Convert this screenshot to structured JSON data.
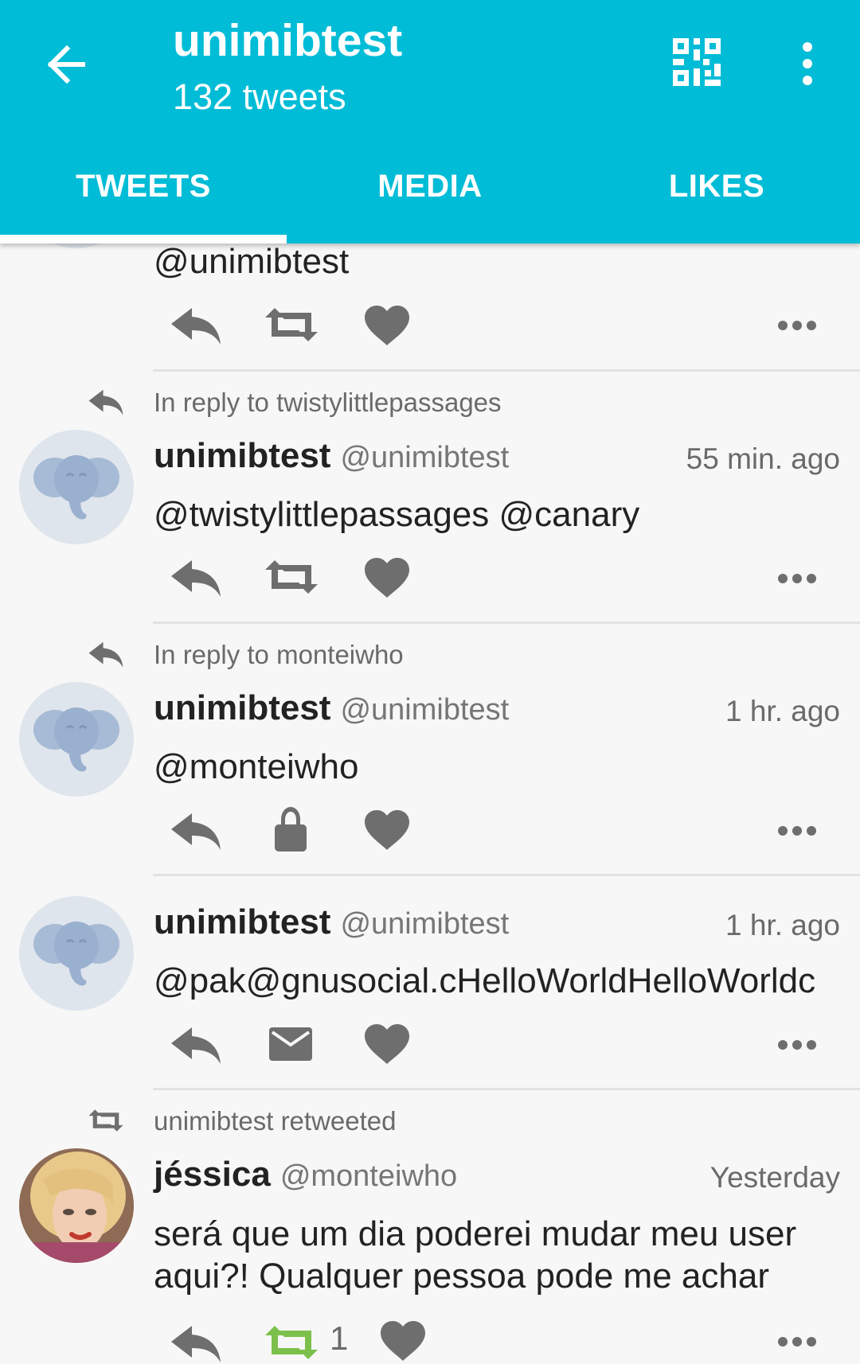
{
  "header": {
    "title": "unimibtest",
    "subtitle": "132 tweets",
    "tabs": [
      "TWEETS",
      "MEDIA",
      "LIKES"
    ]
  },
  "colors": {
    "accent": "#00bcd6",
    "icon_gray": "#6e6e6e",
    "retweet_green": "#7cc04b"
  },
  "feed": {
    "partial": {
      "text": "@unimibtest"
    },
    "tweets": [
      {
        "context": "In reply to twistylittlepassages",
        "name": "unimibtest",
        "handle": "@unimibtest",
        "time": "55 min. ago",
        "text": "@twistylittlepassages @canary",
        "second_action_icon": "retweet-icon"
      },
      {
        "context": "In reply to monteiwho",
        "name": "unimibtest",
        "handle": "@unimibtest",
        "time": "1 hr. ago",
        "text": "@monteiwho",
        "second_action_icon": "lock-icon"
      },
      {
        "name": "unimibtest",
        "handle": "@unimibtest",
        "time": "1 hr. ago",
        "text": "@pak@gnusocial.cHelloWorldHelloWorldc",
        "second_action_icon": "mail-icon"
      },
      {
        "context": "unimibtest retweeted",
        "name": "jéssica",
        "handle": "@monteiwho",
        "time": "Yesterday",
        "text": "será que um dia poderei mudar meu user aqui?! Qualquer pessoa pode me achar",
        "retweet_count": "1",
        "second_action_icon": "retweet-icon"
      }
    ]
  }
}
